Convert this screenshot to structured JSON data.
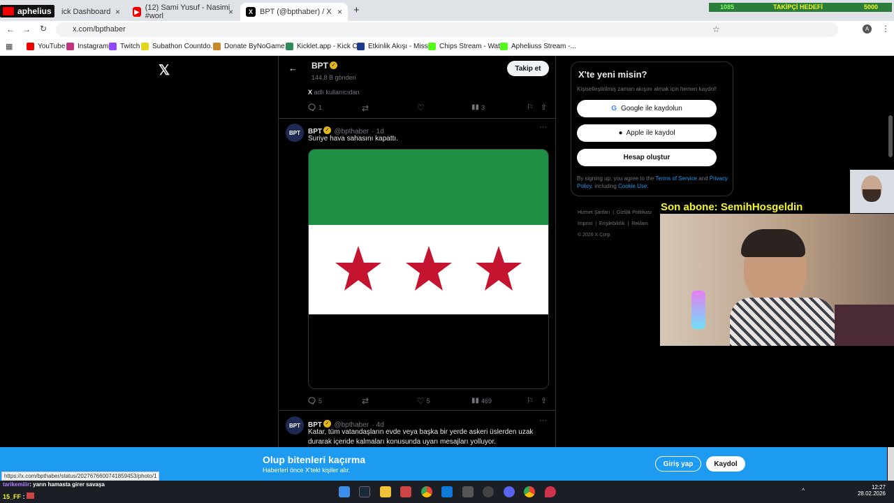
{
  "browser": {
    "tabs": [
      {
        "label": "ick Dashboard",
        "close": "×"
      },
      {
        "label": "(12) Sami Yusuf - Nasimi #worl",
        "close": "×"
      },
      {
        "label": "BPT (@bpthaber) / X",
        "close": "×"
      }
    ],
    "new_tab": "+",
    "url": "x.com/bpthaber",
    "bookmarks": [
      "YouTube",
      "Instagram",
      "Twitch",
      "Subathon Countdo...",
      "Donate ByNoGame...",
      "Kicklet.app - Kick C...",
      "Etkinlik Akışı - Miss...",
      "Chips Stream - Wat...",
      "Apheliuss Stream -..."
    ],
    "status_url": "https://x.com/bpthaber/status/2027676600741859453/photo/1"
  },
  "overlay": {
    "logo_text": "aphelius",
    "follower_current": "1085",
    "follower_label": "TAKİPÇİ HEDEFİ",
    "follower_target": "5000",
    "last_sub": "Son abone: SemihHosgeldin",
    "chat_line1_user": "tarikemiiir",
    "chat_line1_text": ": yarın hamasta girer savaşa",
    "chat_line2_user": "15_FF",
    "chat_line2_text": ":"
  },
  "profile_header": {
    "name": "BPT",
    "posts": "144,8 B gönderi",
    "follow": "Takip et",
    "back": "←"
  },
  "tweet0": {
    "source_x": "X",
    "source_text": "adlı kullanıcıdan",
    "replies": "1",
    "views": "3"
  },
  "tweet1": {
    "name": "BPT",
    "handle": "@bpthaber",
    "time": "· 1d",
    "text": "Suriye hava sahasını kapattı.",
    "replies": "5",
    "likes": "5",
    "views": "469",
    "more": "···"
  },
  "tweet2": {
    "name": "BPT",
    "handle": "@bpthaber",
    "time": "· 4d",
    "text": "Katar, tüm vatandaşların evde veya başka bir yerde askeri üslerden uzak durarak içeride kalmaları konusunda uyarı mesajları yolluyor.",
    "more": "···"
  },
  "avatar_text": "BPT",
  "sidebar": {
    "title": "X'te yeni misin?",
    "subtitle": "Kişiselleştirilmiş zaman akışını almak için hemen kaydol!",
    "google": "Google ile kaydolun",
    "apple": "Apple ile kaydol",
    "create": "Hesap oluştur",
    "legal_a": "By signing up, you agree to the",
    "terms": "Terms of Service",
    "legal_b": "and",
    "privacy": "Privacy Policy",
    "legal_c": ", including",
    "cookie": "Cookie Use",
    "legal_d": "."
  },
  "footer_links": [
    "Hizmet Şartları",
    "Gizlilik Politikası",
    "Imprint",
    "Erişilebilirlik",
    "Reklam"
  ],
  "copyright": "© 2026 X Corp.",
  "banner": {
    "title": "Olup bitenleri kaçırma",
    "subtitle": "Haberleri önce X'teki kişiler alır.",
    "login": "Giriş yap",
    "signup": "Kaydol"
  },
  "clock": {
    "time": "12:27",
    "date": "28.02.2026"
  },
  "colors": {
    "x_blue": "#1d9bf0",
    "flag_green": "#1f8f45",
    "flag_red": "#c4142f",
    "overlay_yellow": "#f4f71c"
  }
}
